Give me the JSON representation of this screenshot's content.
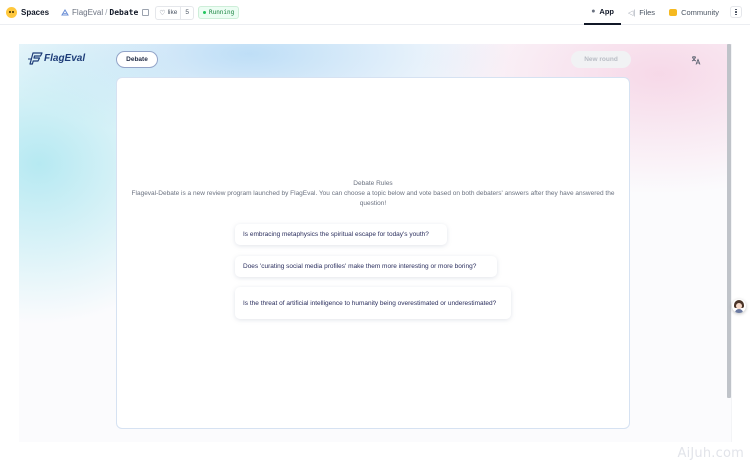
{
  "header": {
    "spaces_label": "Spaces",
    "owner": "FlagEval",
    "repo_name": "Debate",
    "like_label": "like",
    "like_count": "5",
    "status": "Running",
    "tabs": [
      {
        "label": "App",
        "icon": "app-icon",
        "active": true
      },
      {
        "label": "Files",
        "icon": "files-icon",
        "active": false
      },
      {
        "label": "Community",
        "icon": "community-icon",
        "active": false
      }
    ]
  },
  "app": {
    "brand": "FlagEval",
    "mode_button": "Debate",
    "new_round_button": "New round",
    "rules_title": "Debate Rules",
    "rules_text": "Flageval-Debate is a new review program launched by FlagEval. You can choose a topic below and vote based on both debaters' answers after they have answered the question!",
    "topics": [
      "Is embracing metaphysics the spiritual escape for today's youth?",
      "Does 'curating social media profiles' make them more interesting or more boring?",
      "Is the threat of artificial intelligence to humanity being overestimated or underestimated?"
    ]
  },
  "watermark": "AiJuh.com",
  "colors": {
    "brand": "#1d3c78",
    "status_green": "#22c55e",
    "panel_border": "#d6e2f2"
  }
}
